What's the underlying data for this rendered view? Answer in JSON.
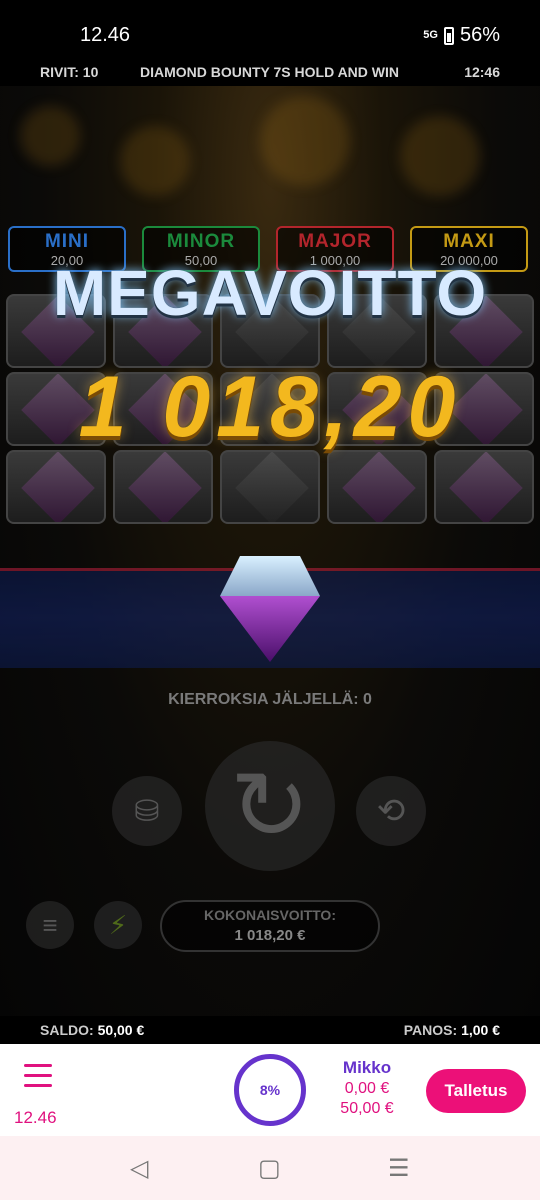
{
  "status": {
    "time": "12.46",
    "network": "5G",
    "battery": "56%"
  },
  "game": {
    "lines_label": "RIVIT: 10",
    "title": "DIAMOND BOUNTY 7S HOLD AND WIN",
    "clock": "12:46",
    "jackpots": [
      {
        "name": "MINI",
        "value": "20,00",
        "color": "#2a6fc8"
      },
      {
        "name": "MINOR",
        "value": "50,00",
        "color": "#1b8a3c"
      },
      {
        "name": "MAJOR",
        "value": "1 000,00",
        "color": "#b3252c"
      },
      {
        "name": "MAXI",
        "value": "20 000,00",
        "color": "#c49a14"
      }
    ],
    "win_title": "MEGAVOITTO",
    "win_amount": "1 018,20",
    "rounds_left": "KIERROKSIA JÄLJELLÄ: 0",
    "total_win_label": "KOKONAISVOITTO:",
    "total_win_value": "1 018,20 €"
  },
  "balance": {
    "saldo_label": "SALDO:",
    "saldo_value": "50,00 €",
    "panos_label": "PANOS:",
    "panos_value": "1,00 €"
  },
  "appbar": {
    "time": "12.46",
    "progress": "8%",
    "user_name": "Mikko",
    "bonus": "0,00 €",
    "cash": "50,00 €",
    "deposit_label": "Talletus"
  },
  "nav": {
    "back": "◁",
    "home": "▢",
    "recents": "☰"
  }
}
